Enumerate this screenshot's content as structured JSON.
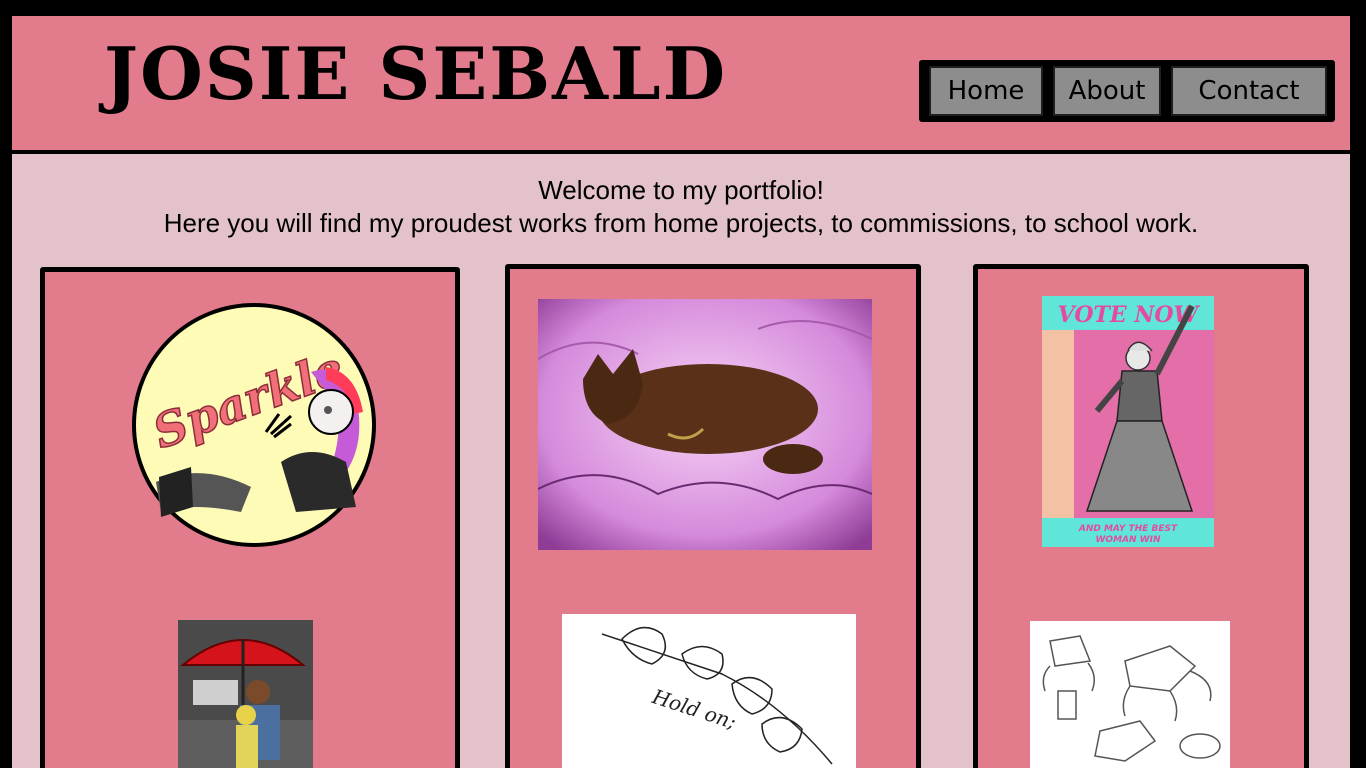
{
  "header": {
    "site_title": "JOSIE SEBALD",
    "nav": {
      "home_label": "Home",
      "about_label": "About",
      "contact_label": "Contact"
    }
  },
  "main": {
    "welcome_line1": "Welcome to my portfolio!",
    "welcome_line2": "Here you will find my proudest works from home projects, to commissions, to school work."
  },
  "gallery": {
    "sparkle_badge_text": "Sparkle",
    "vote_poster_top": "VOTE NOW",
    "vote_poster_bottom_1": "AND MAY THE BEST",
    "vote_poster_bottom_2": "WOMAN WIN",
    "flower_sketch_text": "Hold on;"
  },
  "colors": {
    "header_bg": "#e27b8b",
    "page_bg": "#e3c3c9",
    "nav_button": "#8d8d8d",
    "border": "#000000"
  }
}
